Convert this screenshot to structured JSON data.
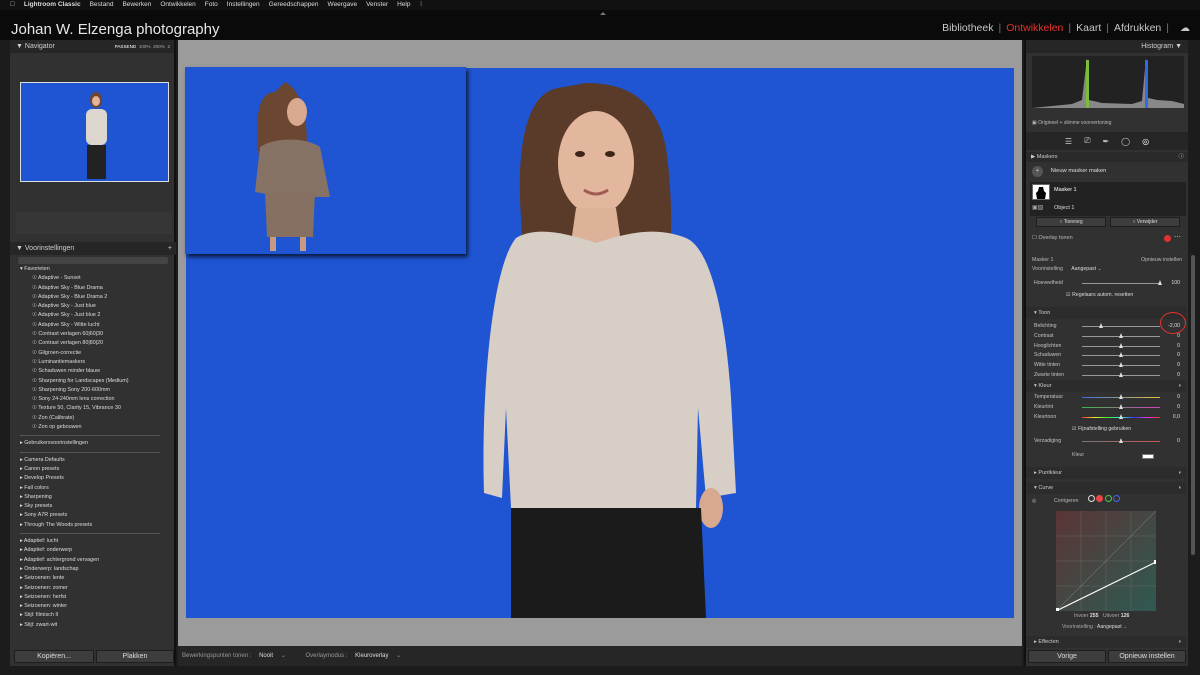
{
  "menubar": {
    "items": [
      "Lightroom Classic",
      "Bestand",
      "Bewerken",
      "Ontwikkelen",
      "Foto",
      "Instellingen",
      "Gereedschappen",
      "Weergave",
      "Venster",
      "Help"
    ]
  },
  "identity_plate": "Johan W. Elzenga photography",
  "modules": [
    "Bibliotheek",
    "Ontwikkelen",
    "Kaart",
    "Afdrukken"
  ],
  "active_module": "Ontwikkelen",
  "navigator": {
    "title": "Navigator",
    "zoom": [
      "PASSEND",
      "100%",
      "200%",
      "2"
    ]
  },
  "presets": {
    "title": "Voorinstellingen",
    "favorites_label": "Favorieten",
    "favorites": [
      "Adaptive - Sunset",
      "Adaptive Sky - Blue Drama",
      "Adaptive Sky - Blue Drama 2",
      "Adaptive Sky - Just blue",
      "Adaptive Sky - Just blue 2",
      "Adaptive Sky - Witte lucht",
      "Contrast verlagen 60|60|30",
      "Contrast verlagen 80|80|20",
      "Gilgroen-correctie",
      "Luminantiemaskers",
      "Schaduwen minder blauw",
      "Sharpening for Landscapes (Medium)",
      "Sharpening Sony 200-600mm",
      "Sony 24-240mm lens correction",
      "Texture 50, Clarity 15, Vibrance 30",
      "Zon (Calibrate)",
      "Zon op gebouwen"
    ],
    "user_label": "Gebruikersvoorinstellingen",
    "groups1": [
      "Camera Defaults",
      "Canon presets",
      "Develop Presets",
      "Fall colors",
      "Sharpening",
      "Sky presets",
      "Sony A7R presets",
      "Through The Woods presets"
    ],
    "groups2": [
      "Adaptief: lucht",
      "Adaptief: onderwerp",
      "Adaptief: achtergrond vervagen",
      "Onderwerp: landschap",
      "Seizoenen: lente",
      "Seizoenen: zomer",
      "Seizoenen: herfst",
      "Seizoenen: winter",
      "Stijl: filmisch II",
      "Stijl: zwart-wit"
    ]
  },
  "left_buttons": {
    "copy": "Kopiëren...",
    "paste": "Plakken"
  },
  "bottombar": {
    "label1": "Bewerkingspunten tonen :",
    "value1": "Nooit",
    "label2": "Overlaymodus :",
    "value2": "Kleuroverlay"
  },
  "histogram": {
    "title": "Histogram",
    "caption": "Origineel + slimme voorvertoning"
  },
  "masks": {
    "title": "Maskers",
    "new_mask": "Nieuw masker maken",
    "mask1": "Masker 1",
    "object1": "Object 1",
    "add": "Toevoeg",
    "remove": "Verwijder",
    "overlay": "Overlay tonen"
  },
  "mask_panel": {
    "name": "Masker 1",
    "reset": "Opnieuw instellen",
    "preset_label": "Voorinstelling",
    "preset_value": "Aangepast",
    "amount_label": "Hoeveelheid",
    "amount_value": "100",
    "auto_reset": "Regelaars autom. resetten"
  },
  "tone": {
    "title": "Toon",
    "sliders": [
      {
        "label": "Belichting",
        "value": "-2,00",
        "pos": 0.25
      },
      {
        "label": "Contrast",
        "value": "0",
        "pos": 0.5
      },
      {
        "label": "Hooglichten",
        "value": "0",
        "pos": 0.5
      },
      {
        "label": "Schaduwen",
        "value": "0",
        "pos": 0.5
      },
      {
        "label": "Witte tinten",
        "value": "0",
        "pos": 0.5
      },
      {
        "label": "Zwarte tinten",
        "value": "0",
        "pos": 0.5
      }
    ]
  },
  "color": {
    "title": "Kleur",
    "sliders": [
      {
        "label": "Temperatuur",
        "value": "0",
        "pos": 0.5
      },
      {
        "label": "Kleurtint",
        "value": "0",
        "pos": 0.5
      },
      {
        "label": "Kleurtoon",
        "value": "0,0",
        "pos": 0.5
      }
    ],
    "fine_tune": "Fijnafstelling gebruiken",
    "saturation_label": "Verzadiging",
    "saturation_value": "0",
    "color_label": "Kleur"
  },
  "point_color": {
    "title": "Puntkleur"
  },
  "curve": {
    "title": "Curve",
    "channels_label": "Corrigeren",
    "input_label": "Invoer",
    "input_value": "255",
    "output_label": "Uitvoer",
    "output_value": "126",
    "preset_label": "Voorinstelling :",
    "preset_value": "Aangepast"
  },
  "effects": {
    "title": "Effecten"
  },
  "right_buttons": {
    "prev": "Vorige",
    "reset": "Opnieuw instellen"
  },
  "colors": {
    "accent_red": "#e8332e",
    "photo_blue": "#1f55d2"
  }
}
